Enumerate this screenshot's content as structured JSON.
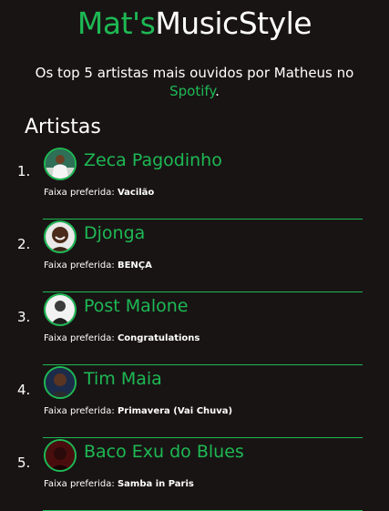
{
  "header": {
    "title_part1": "Mat's",
    "title_part2": "MusicStyle",
    "subtitle_text": "Os top 5 artistas mais ouvidos por Matheus no",
    "subtitle_link": "Spotify",
    "subtitle_end": "."
  },
  "section": {
    "title": "Artistas"
  },
  "track_label": "Faixa preferida: ",
  "artists": [
    {
      "rank": "1.",
      "name": "Zeca Pagodinho",
      "track": "Vacilão"
    },
    {
      "rank": "2.",
      "name": "Djonga",
      "track": "BENÇA"
    },
    {
      "rank": "3.",
      "name": "Post Malone",
      "track": "Congratulations"
    },
    {
      "rank": "4.",
      "name": "Tim Maia",
      "track": "Primavera (Vai Chuva)"
    },
    {
      "rank": "5.",
      "name": "Baco Exu do Blues",
      "track": "Samba in Paris"
    }
  ],
  "colors": {
    "accent": "#1db954",
    "background": "#191414",
    "text": "#ffffff"
  }
}
